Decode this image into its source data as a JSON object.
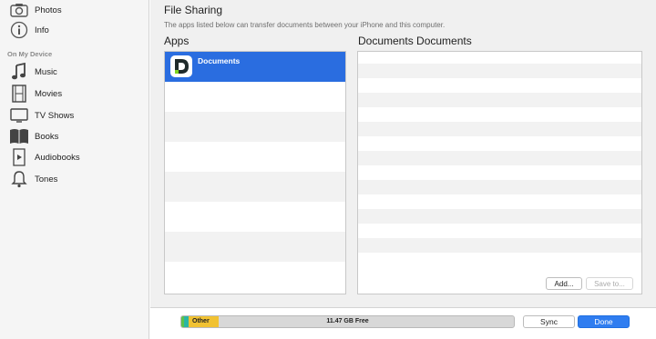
{
  "sidebar": {
    "items_top": [
      {
        "label": "Photos",
        "icon": "camera-icon"
      },
      {
        "label": "Info",
        "icon": "info-icon"
      }
    ],
    "section_header": "On My Device",
    "items_device": [
      {
        "label": "Music",
        "icon": "music-note-icon"
      },
      {
        "label": "Movies",
        "icon": "film-icon"
      },
      {
        "label": "TV Shows",
        "icon": "tv-icon"
      },
      {
        "label": "Books",
        "icon": "book-icon"
      },
      {
        "label": "Audiobooks",
        "icon": "audiobook-icon"
      },
      {
        "label": "Tones",
        "icon": "bell-icon"
      }
    ]
  },
  "file_sharing": {
    "title": "File Sharing",
    "description": "The apps listed below can transfer documents between your iPhone and this computer.",
    "apps_header": "Apps",
    "documents_header": "Documents Documents",
    "apps": [
      {
        "name": "Documents",
        "icon_letter": "D",
        "selected": true
      }
    ],
    "add_button": "Add...",
    "save_button": "Save to..."
  },
  "footer": {
    "storage_other_label": "Other",
    "storage_free_label": "11.47 GB Free",
    "sync_button": "Sync",
    "done_button": "Done"
  },
  "colors": {
    "selection": "#2a6de0",
    "other_segment": "#f1c232",
    "done_button": "#2f7df0"
  }
}
